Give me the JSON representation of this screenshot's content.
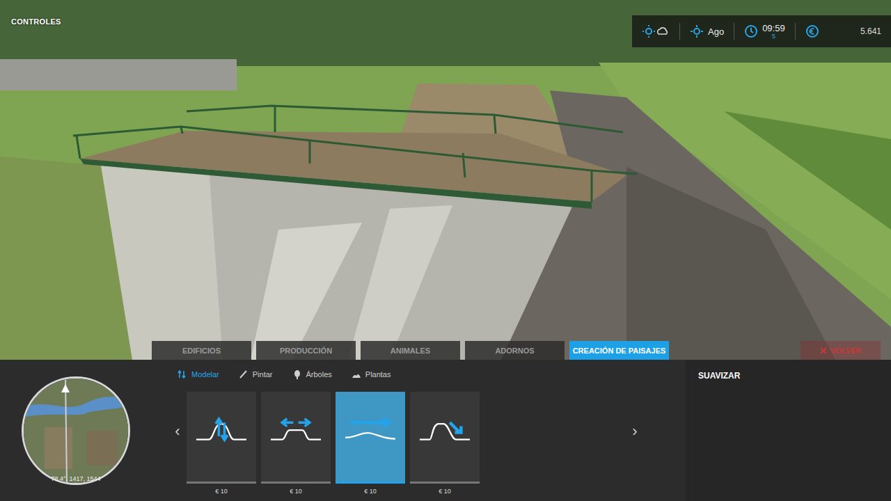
{
  "hud": {
    "controls_label": "CONTROLES",
    "month": "Ago",
    "time": "09:59",
    "time_speed": "5",
    "money": "5.641"
  },
  "category_tabs": [
    {
      "label": "EDIFICIOS",
      "selected": false
    },
    {
      "label": "PRODUCCIÓN",
      "selected": false
    },
    {
      "label": "ANIMALES",
      "selected": false
    },
    {
      "label": "ADORNOS",
      "selected": false
    },
    {
      "label": "CREACIÓN DE PAISAJES",
      "selected": true
    }
  ],
  "back_button": {
    "label": "VOLVER"
  },
  "subtabs": [
    {
      "label": "Modelar",
      "selected": true
    },
    {
      "label": "Pintar",
      "selected": false
    },
    {
      "label": "Árboles",
      "selected": false
    },
    {
      "label": "Plantas",
      "selected": false
    }
  ],
  "tools": [
    {
      "kind": "raise",
      "price": "€ 10",
      "selected": false
    },
    {
      "kind": "level",
      "price": "€ 10",
      "selected": false
    },
    {
      "kind": "smooth",
      "price": "€ 10",
      "selected": true
    },
    {
      "kind": "slope",
      "price": "€ 10",
      "selected": false
    }
  ],
  "nav": {
    "prev": "‹",
    "next": "›"
  },
  "selected_tool_name": "SUAVIZAR",
  "minimap": {
    "coordinates": "78.4°, 1417, 1544"
  }
}
